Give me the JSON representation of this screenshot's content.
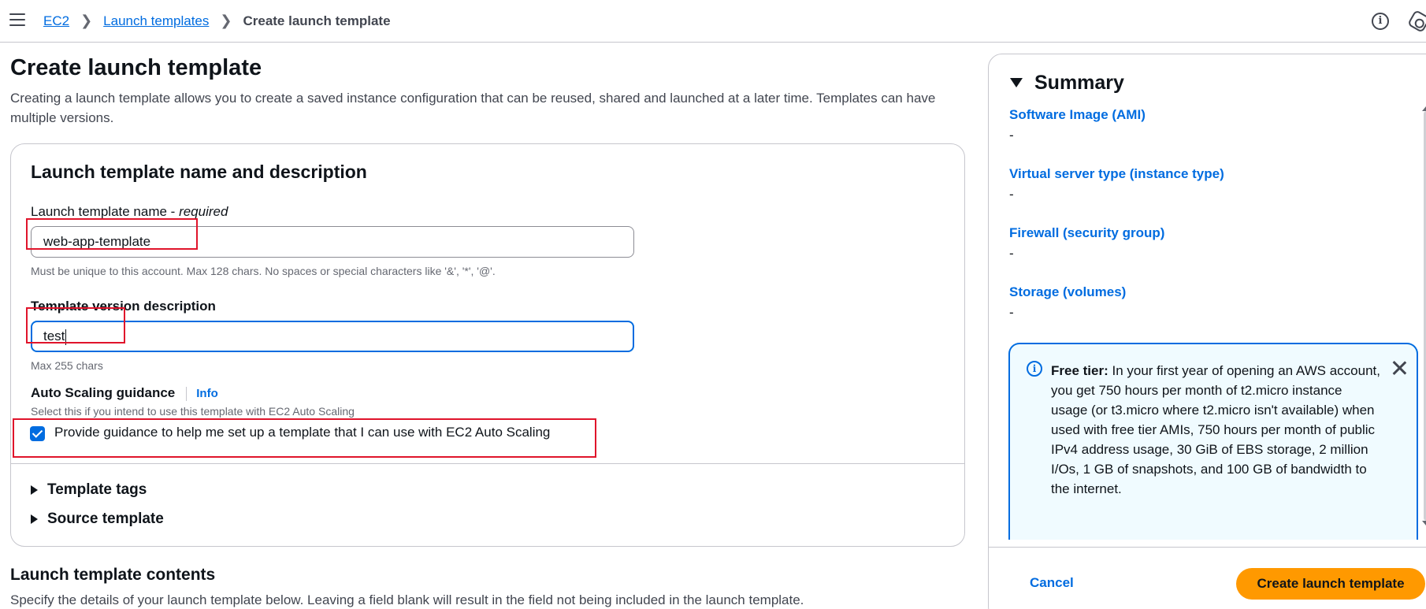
{
  "breadcrumb": {
    "items": [
      {
        "label": "EC2"
      },
      {
        "label": "Launch templates"
      },
      {
        "label": "Create launch template"
      }
    ]
  },
  "page": {
    "title": "Create launch template",
    "description": "Creating a launch template allows you to create a saved instance configuration that can be reused, shared and launched at a later time. Templates can have multiple versions."
  },
  "name_section": {
    "heading": "Launch template name and description",
    "name_label": "Launch template name - ",
    "name_required": "required",
    "name_value": "web-app-template",
    "name_help": "Must be unique to this account. Max 128 chars. No spaces or special characters like '&', '*', '@'.",
    "version_label": "Template version description",
    "version_value": "test",
    "version_help": "Max 255 chars",
    "autoscaling_label": "Auto Scaling guidance",
    "autoscaling_info": "Info",
    "autoscaling_help": "Select this if you intend to use this template with EC2 Auto Scaling",
    "autoscaling_checkbox_label": "Provide guidance to help me set up a template that I can use with EC2 Auto Scaling",
    "autoscaling_checked": true,
    "template_tags": "Template tags",
    "source_template": "Source template"
  },
  "contents_section": {
    "title": "Launch template contents",
    "description": "Specify the details of your launch template below. Leaving a field blank will result in the field not being included in the launch template."
  },
  "summary": {
    "title": "Summary",
    "items": [
      {
        "label": "Software Image (AMI)",
        "value": "-"
      },
      {
        "label": "Virtual server type (instance type)",
        "value": "-"
      },
      {
        "label": "Firewall (security group)",
        "value": "-"
      },
      {
        "label": "Storage (volumes)",
        "value": "-"
      }
    ],
    "free_tier_title": "Free tier:",
    "free_tier_text": " In your first year of opening an AWS account, you get 750 hours per month of t2.micro instance usage (or t3.micro where t2.micro isn't available) when used with free tier AMIs, 750 hours per month of public IPv4 address usage, 30 GiB of EBS storage, 2 million I/Os, 1 GB of snapshots, and 100 GB of bandwidth to the internet.",
    "cancel_label": "Cancel",
    "create_label": "Create launch template"
  },
  "colors": {
    "link": "#006ce0",
    "primary_button": "#ff9900",
    "highlight": "#e0142b",
    "info_bg": "#f0fbff"
  },
  "icons": [
    "menu-icon",
    "chevron-right-icon",
    "info-icon",
    "settings-icon",
    "caret-down-icon",
    "caret-right-icon",
    "close-icon",
    "checkmark-icon"
  ]
}
